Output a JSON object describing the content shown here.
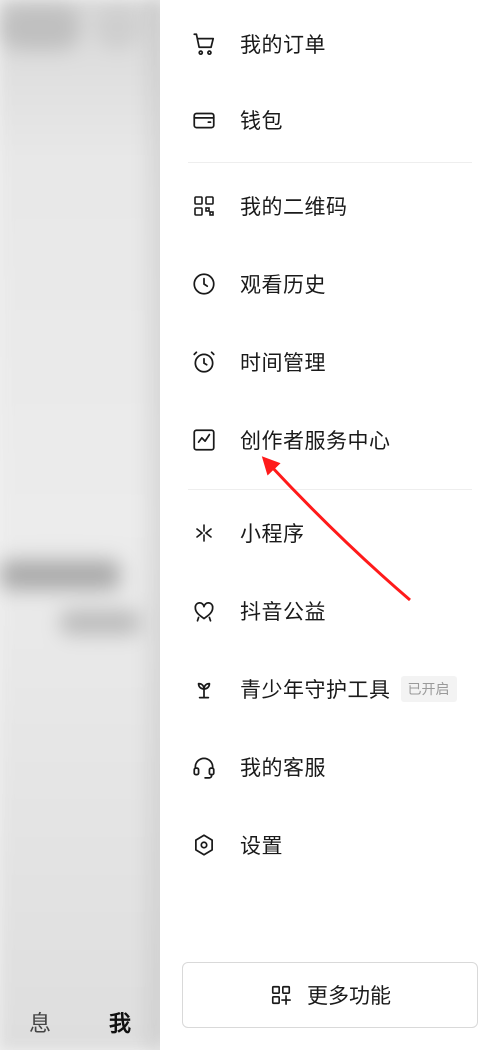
{
  "menu": {
    "groups": [
      [
        {
          "key": "orders",
          "label": "我的订单"
        },
        {
          "key": "wallet",
          "label": "钱包"
        }
      ],
      [
        {
          "key": "qrcode",
          "label": "我的二维码"
        },
        {
          "key": "history",
          "label": "观看历史"
        },
        {
          "key": "timemgmt",
          "label": "时间管理"
        },
        {
          "key": "creator",
          "label": "创作者服务中心"
        }
      ],
      [
        {
          "key": "miniprog",
          "label": "小程序"
        },
        {
          "key": "charity",
          "label": "抖音公益"
        },
        {
          "key": "teen",
          "label": "青少年守护工具",
          "badge": "已开启"
        },
        {
          "key": "support",
          "label": "我的客服"
        },
        {
          "key": "settings",
          "label": "设置"
        }
      ]
    ]
  },
  "footer": {
    "more_label": "更多功能"
  },
  "tabs": {
    "messages": "息",
    "me": "我"
  },
  "highlighted_item_key": "creator",
  "arrow_color": "#ff1a1a"
}
